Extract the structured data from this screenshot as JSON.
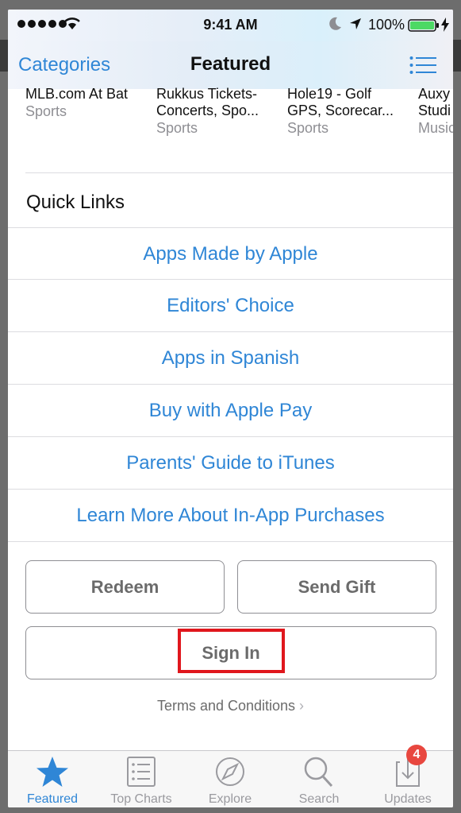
{
  "status_bar": {
    "time": "9:41 AM",
    "battery": "100%"
  },
  "nav": {
    "left": "Categories",
    "title": "Featured"
  },
  "apps": [
    {
      "name_line1": "MLB.com At Bat",
      "name_line2": "",
      "category": "Sports"
    },
    {
      "name_line1": "Rukkus Tickets-",
      "name_line2": "Concerts, Spo...",
      "category": "Sports"
    },
    {
      "name_line1": "Hole19 - Golf",
      "name_line2": "GPS, Scorecar...",
      "category": "Sports"
    },
    {
      "name_line1": "Auxy",
      "name_line2": "Studi",
      "category": "Music"
    }
  ],
  "quick_links": {
    "title": "Quick Links",
    "items": [
      "Apps Made by Apple",
      "Editors' Choice",
      "Apps in Spanish",
      "Buy with Apple Pay",
      "Parents' Guide to iTunes",
      "Learn More About In-App Purchases"
    ]
  },
  "buttons": {
    "redeem": "Redeem",
    "send_gift": "Send Gift",
    "sign_in": "Sign In"
  },
  "terms": "Terms and Conditions",
  "tabs": [
    {
      "label": "Featured",
      "icon": "star-icon",
      "active": true
    },
    {
      "label": "Top Charts",
      "icon": "list-icon",
      "active": false
    },
    {
      "label": "Explore",
      "icon": "compass-icon",
      "active": false
    },
    {
      "label": "Search",
      "icon": "search-icon",
      "active": false
    },
    {
      "label": "Updates",
      "icon": "download-icon",
      "active": false
    }
  ],
  "updates_badge": "4",
  "colors": {
    "accent": "#2f86d6",
    "highlight": "#e0171d",
    "badge": "#e8473f"
  }
}
